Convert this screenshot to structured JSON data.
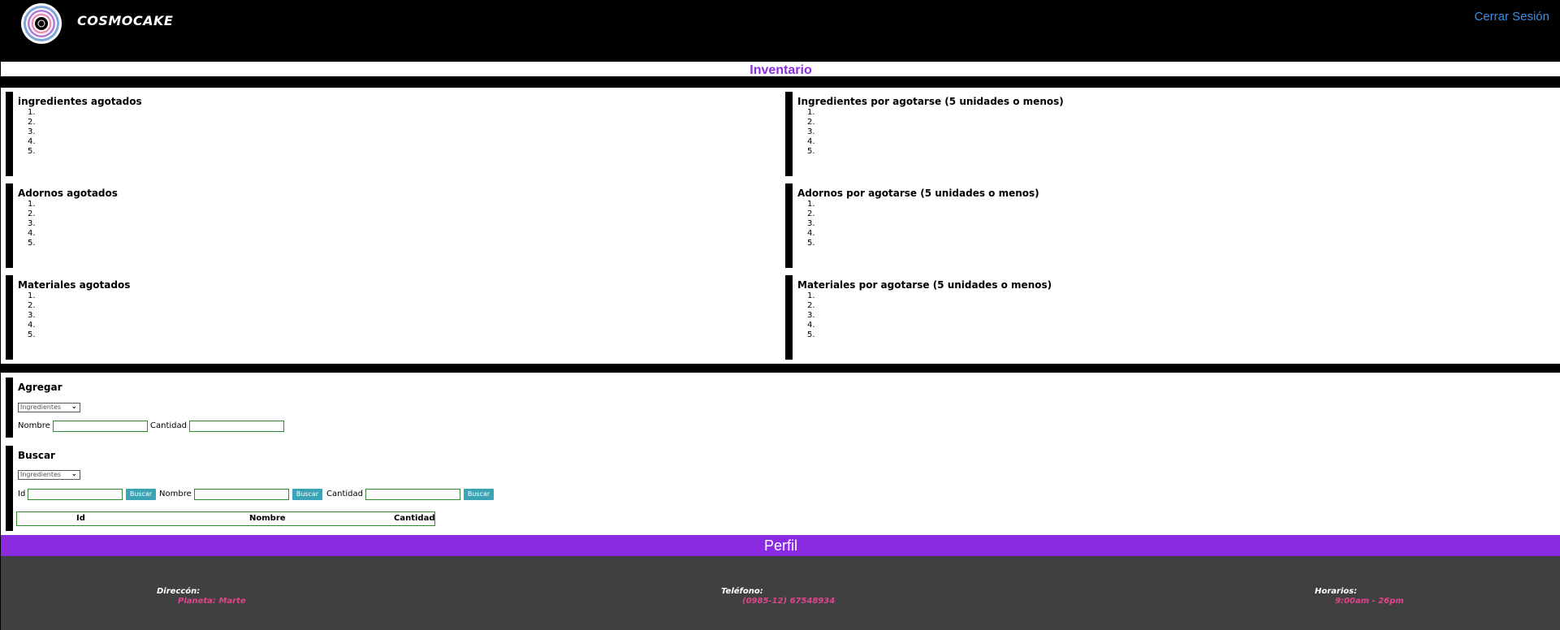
{
  "header": {
    "brand": "COSMOCAKE",
    "logout": "Cerrar Sesión"
  },
  "page_title": "Inventario",
  "panels": {
    "ingredientes_agotados": {
      "title": "ingredientes agotados",
      "items": [
        "1.",
        "2.",
        "3.",
        "4.",
        "5."
      ]
    },
    "ingredientes_por_agotarse": {
      "title": "Ingredientes por agotarse (5 unidades o menos)",
      "items": [
        "1.",
        "2.",
        "3.",
        "4.",
        "5."
      ]
    },
    "adornos_agotados": {
      "title": "Adornos agotados",
      "items": [
        "1.",
        "2.",
        "3.",
        "4.",
        "5."
      ]
    },
    "adornos_por_agotarse": {
      "title": "Adornos por agotarse (5 unidades o menos)",
      "items": [
        "1.",
        "2.",
        "3.",
        "4.",
        "5."
      ]
    },
    "materiales_agotados": {
      "title": "Materiales agotados",
      "items": [
        "1.",
        "2.",
        "3.",
        "4.",
        "5."
      ]
    },
    "materiales_por_agotarse": {
      "title": "Materiales por agotarse (5 unidades o menos)",
      "items": [
        "1.",
        "2.",
        "3.",
        "4.",
        "5."
      ]
    }
  },
  "agregar": {
    "title": "Agregar",
    "category": "Ingredientes",
    "nombre_label": "Nombre",
    "cantidad_label": "Cantidad"
  },
  "buscar": {
    "title": "Buscar",
    "category": "Ingredientes",
    "id_label": "Id",
    "nombre_label": "Nombre",
    "cantidad_label": "Cantidad",
    "button_label": "Buscar",
    "table_headers": [
      "Id",
      "Nombre",
      "Cantidad"
    ]
  },
  "perfil": "Perfil",
  "footer": {
    "direccion_label": "Direccón:",
    "direccion_value": "Planeta: Marte",
    "telefono_label": "Teléfono:",
    "telefono_value": "(0985-12) 67548934",
    "horarios_label": "Horarios:",
    "horarios_value": "9:00am - 26pm"
  },
  "colors": {
    "accent": "#8a2be2",
    "link": "#3d8ee0",
    "button": "#3aa3b5",
    "footer_bg": "#404040",
    "footer_value": "#e0458c"
  }
}
